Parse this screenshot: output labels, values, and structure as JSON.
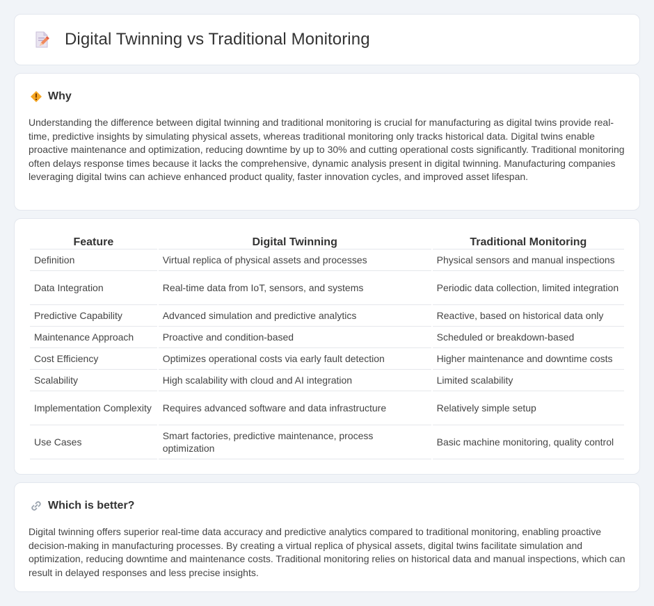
{
  "header": {
    "title": "Digital Twinning vs Traditional Monitoring",
    "icon": "document-pencil-icon"
  },
  "why": {
    "icon": "warning-diamond-icon",
    "title": "Why",
    "text": "Understanding the difference between digital twinning and traditional monitoring is crucial for manufacturing as digital twins provide real-time, predictive insights by simulating physical assets, whereas traditional monitoring only tracks historical data. Digital twins enable proactive maintenance and optimization, reducing downtime by up to 30% and cutting operational costs significantly. Traditional monitoring often delays response times because it lacks the comprehensive, dynamic analysis present in digital twinning. Manufacturing companies leveraging digital twins can achieve enhanced product quality, faster innovation cycles, and improved asset lifespan."
  },
  "table": {
    "headers": [
      "Feature",
      "Digital Twinning",
      "Traditional Monitoring"
    ],
    "rows": [
      [
        "Definition",
        "Virtual replica of physical assets and processes",
        "Physical sensors and manual inspections"
      ],
      [
        "Data Integration",
        "Real-time data from IoT, sensors, and systems",
        "Periodic data collection, limited integration"
      ],
      [
        "Predictive Capability",
        "Advanced simulation and predictive analytics",
        "Reactive, based on historical data only"
      ],
      [
        "Maintenance Approach",
        "Proactive and condition-based",
        "Scheduled or breakdown-based"
      ],
      [
        "Cost Efficiency",
        "Optimizes operational costs via early fault detection",
        "Higher maintenance and downtime costs"
      ],
      [
        "Scalability",
        "High scalability with cloud and AI integration",
        "Limited scalability"
      ],
      [
        "Implementation Complexity",
        "Requires advanced software and data infrastructure",
        "Relatively simple setup"
      ],
      [
        "Use Cases",
        "Smart factories, predictive maintenance, process optimization",
        "Basic machine monitoring, quality control"
      ]
    ]
  },
  "better": {
    "icon": "link-icon",
    "title": "Which is better?",
    "text": "Digital twinning offers superior real-time data accuracy and predictive analytics compared to traditional monitoring, enabling proactive decision-making in manufacturing processes. By creating a virtual replica of physical assets, digital twins facilitate simulation and optimization, reducing downtime and maintenance costs. Traditional monitoring relies on historical data and manual inspections, which can result in delayed responses and less precise insights."
  }
}
